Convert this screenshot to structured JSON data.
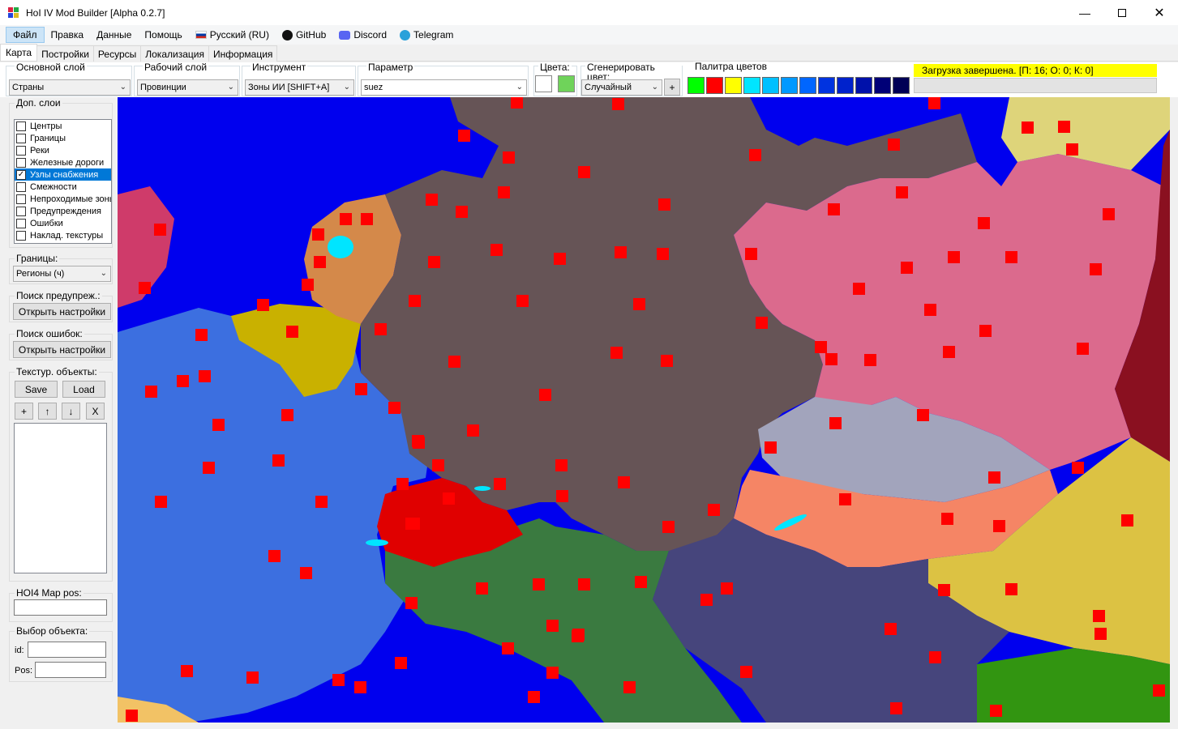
{
  "window": {
    "title": "HoI IV Mod Builder [Alpha 0.2.7]",
    "minimize_icon": "minimize-icon",
    "maximize_icon": "maximize-icon",
    "close_icon": "close-icon"
  },
  "menu": {
    "items": [
      "Файл",
      "Правка",
      "Данные",
      "Помощь"
    ],
    "language": "Русский (RU)",
    "github": "GitHub",
    "discord": "Discord",
    "telegram": "Telegram"
  },
  "tabs": [
    "Карта",
    "Постройки",
    "Ресурсы",
    "Локализация",
    "Информация"
  ],
  "toolbar": {
    "base_layer_label": "Основной слой",
    "base_layer_value": "Страны",
    "work_layer_label": "Рабочий слой",
    "work_layer_value": "Провинции",
    "tool_label": "Инструмент",
    "tool_value": "Зоны ИИ [SHIFT+A]",
    "param_label": "Параметр",
    "param_value": "suez",
    "colors_label": "Цвета:",
    "gen_color_label": "Сгенерировать цвет:",
    "gen_color_value": "Случайный",
    "gen_plus": "+",
    "palette_label": "Палитра цветов",
    "palette": [
      "#00ff00",
      "#ff0000",
      "#ffff00",
      "#00e5ff",
      "#00c0ff",
      "#0099ff",
      "#0066ff",
      "#0033e0",
      "#0022cc",
      "#0011aa",
      "#000077",
      "#000055"
    ],
    "color1": "#ffffff",
    "color2": "#6fd35a"
  },
  "status": {
    "message": "Загрузка завершена. [П: 16; О: 0; К: 0]"
  },
  "sidebar": {
    "extra_layers_label": "Доп. слои",
    "layers": [
      {
        "label": "Центры",
        "checked": false
      },
      {
        "label": "Границы",
        "checked": false
      },
      {
        "label": "Реки",
        "checked": false
      },
      {
        "label": "Железные дороги",
        "checked": false
      },
      {
        "label": "Узлы снабжения",
        "checked": true
      },
      {
        "label": "Смежности",
        "checked": false
      },
      {
        "label": "Непроходимые зоны",
        "checked": false
      },
      {
        "label": "Предупреждения",
        "checked": false
      },
      {
        "label": "Ошибки",
        "checked": false
      },
      {
        "label": "Наклад. текстуры",
        "checked": false
      }
    ],
    "borders_label": "Границы:",
    "borders_value": "Регионы (ч)",
    "warn_search_label": "Поиск предупреж.:",
    "warn_open_settings": "Открыть настройки",
    "err_search_label": "Поиск ошибок:",
    "err_open_settings": "Открыть настройки",
    "tex_objects_label": "Текстур. объекты:",
    "save": "Save",
    "load": "Load",
    "add": "+",
    "up": "↑",
    "down": "↓",
    "remove": "X",
    "map_pos_label": "HOI4 Map pos:",
    "map_pos_value": "",
    "obj_select_label": "Выбор объекта:",
    "id_label": "id:",
    "pos_label": "Pos:"
  }
}
